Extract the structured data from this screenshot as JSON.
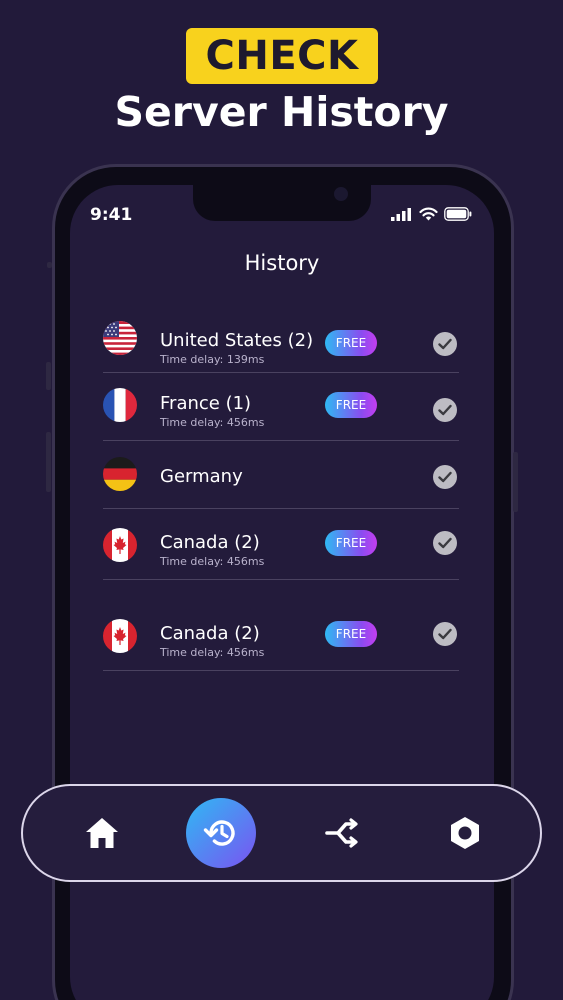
{
  "hero": {
    "badge": "CHECK",
    "title": "Server History"
  },
  "status_bar": {
    "time": "9:41"
  },
  "screen": {
    "title": "History"
  },
  "history": [
    {
      "country": "United States (2)",
      "delay": "Time delay: 139ms",
      "badge": "FREE",
      "flag": "us-flag-icon"
    },
    {
      "country": "France (1)",
      "delay": "Time delay: 456ms",
      "badge": "FREE",
      "flag": "france-flag-icon"
    },
    {
      "country": "Germany",
      "delay": "",
      "badge": "",
      "flag": "germany-flag-icon"
    },
    {
      "country": "Canada (2)",
      "delay": "Time delay: 456ms",
      "badge": "FREE",
      "flag": "canada-flag-icon"
    },
    {
      "country": "Canada (2)",
      "delay": "Time delay: 456ms",
      "badge": "FREE",
      "flag": "canada-flag-icon"
    }
  ],
  "nav": [
    {
      "icon": "home-icon",
      "active": false
    },
    {
      "icon": "history-icon",
      "active": true
    },
    {
      "icon": "split-tunnel-icon",
      "active": false
    },
    {
      "icon": "settings-icon",
      "active": false
    }
  ],
  "colors": {
    "background": "#221a3a",
    "badge_yellow": "#f8d21d",
    "accent_start": "#2fb9f3",
    "accent_end": "#c43ef0"
  }
}
